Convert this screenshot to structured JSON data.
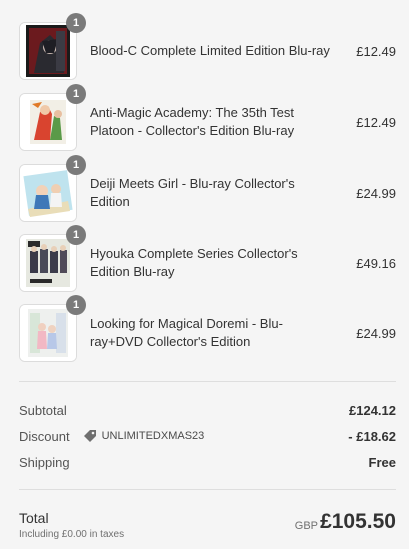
{
  "items": [
    {
      "name": "Blood-C Complete Limited Edition Blu-ray",
      "price": "£12.49",
      "qty": "1",
      "thumb_icon": "blood-c-boxset-thumbnail"
    },
    {
      "name": "Anti-Magic Academy: The 35th Test Platoon - Collector's Edition Blu-ray",
      "price": "£12.49",
      "qty": "1",
      "thumb_icon": "anti-magic-academy-thumbnail"
    },
    {
      "name": "Deiji Meets Girl - Blu-ray Collector's Edition",
      "price": "£24.99",
      "qty": "1",
      "thumb_icon": "deiji-meets-girl-thumbnail"
    },
    {
      "name": "Hyouka Complete Series Collector's Edition Blu-ray",
      "price": "£49.16",
      "qty": "1",
      "thumb_icon": "hyouka-thumbnail"
    },
    {
      "name": "Looking for Magical Doremi - Blu-ray+DVD Collector's Edition",
      "price": "£24.99",
      "qty": "1",
      "thumb_icon": "magical-doremi-thumbnail"
    }
  ],
  "summary": {
    "subtotal_label": "Subtotal",
    "subtotal_value": "£124.12",
    "discount_label": "Discount",
    "discount_code": "UNLIMITEDXMAS23",
    "discount_value": "- £18.62",
    "shipping_label": "Shipping",
    "shipping_value": "Free"
  },
  "total": {
    "label": "Total",
    "tax_note": "Including £0.00 in taxes",
    "currency": "GBP",
    "value": "£105.50"
  },
  "colors": {
    "background": "#f5f5f5",
    "qty_badge": "#7a7a7a",
    "text": "#333333"
  }
}
